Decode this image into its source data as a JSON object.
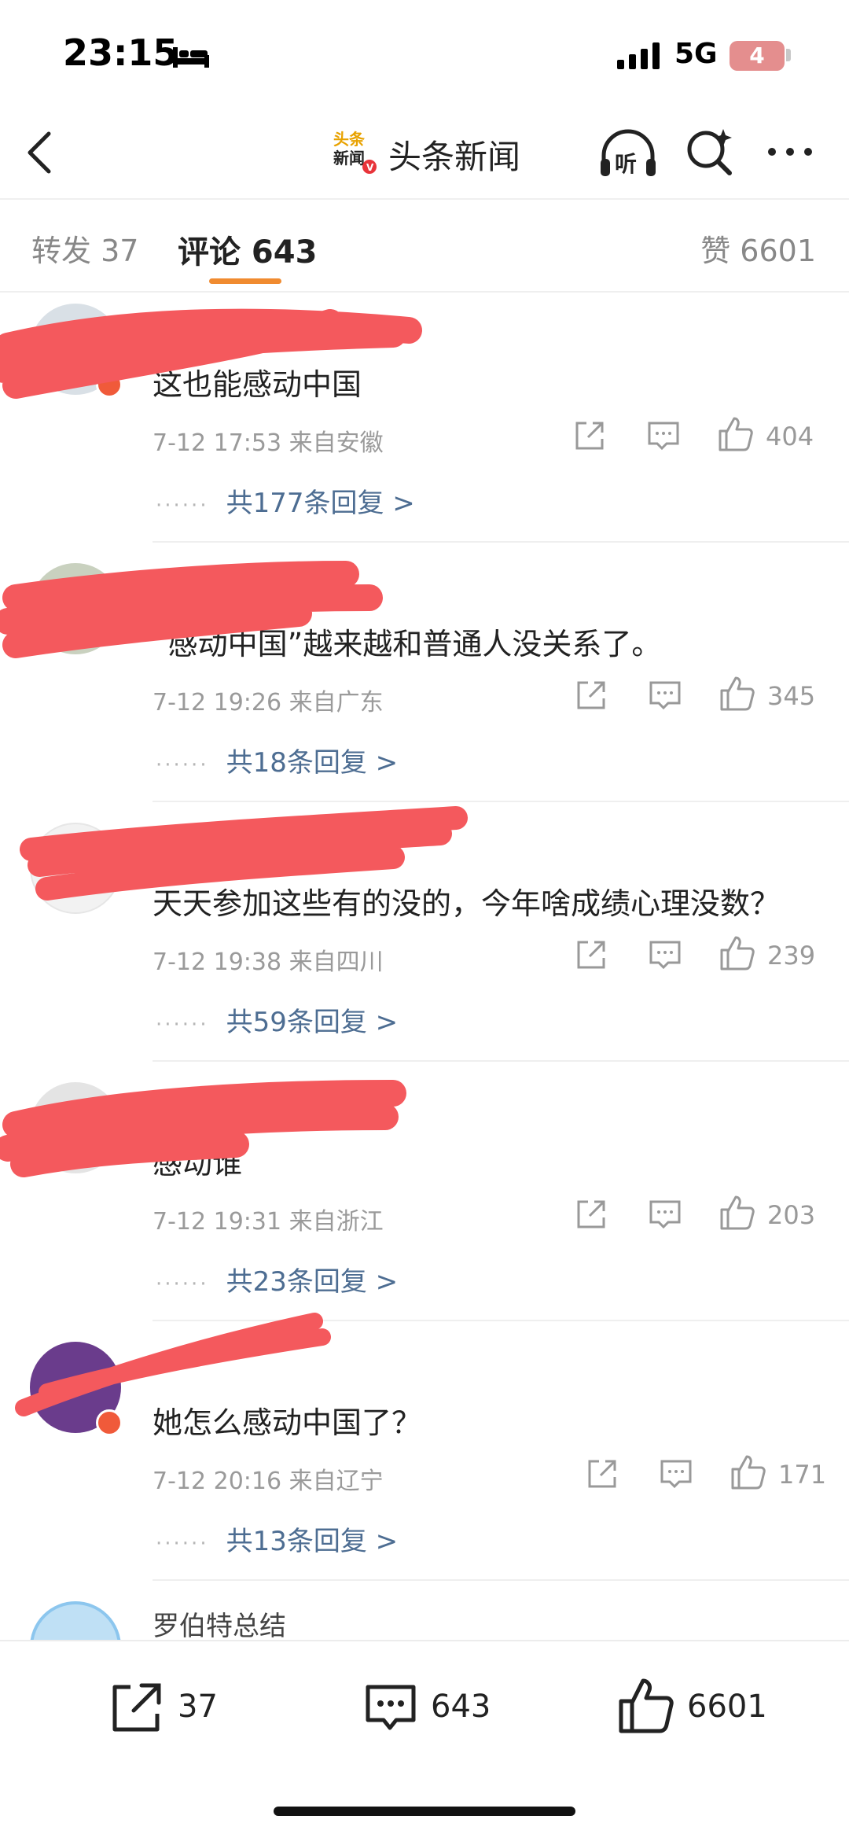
{
  "status_bar": {
    "time": "23:15",
    "network": "5G",
    "battery": "4",
    "icons": [
      "bed-icon",
      "signal-icon"
    ]
  },
  "nav": {
    "title": "头条新闻",
    "logo_text_top": "头条",
    "logo_text_bottom": "新闻",
    "listen_label": "听",
    "icons": [
      "back-icon",
      "listen-icon",
      "search-icon",
      "more-icon"
    ]
  },
  "tabs": {
    "repost": "转发 37",
    "comment": "评论 643",
    "like": "赞 6601",
    "accent_color": "#f08b30"
  },
  "comments": [
    {
      "username": "",
      "text": "这也能感动中国",
      "meta": "7-12 17:53  来自安徽",
      "likes": "404",
      "replies": "共177条回复 >"
    },
    {
      "username": "",
      "text": "“感动中国”越来越和普通人没关系了。",
      "meta": "7-12 19:26  来自广东",
      "likes": "345",
      "replies": "共18条回复 >"
    },
    {
      "username": "",
      "text": "天天参加这些有的没的，今年啥成绩心理没数？",
      "meta": "7-12 19:38  来自四川",
      "likes": "239",
      "replies": "共59条回复 >"
    },
    {
      "username": "",
      "text": "感动谁",
      "meta": "7-12 19:31  来自浙江",
      "likes": "203",
      "replies": "共23条回复 >"
    },
    {
      "username": "",
      "text": "她怎么感动中国了？",
      "meta": "7-12 20:16  来自辽宁",
      "likes": "171",
      "replies": "共13条回复 >"
    }
  ],
  "last_comment": {
    "username": "罗伯特总结"
  },
  "reply_dots": "······",
  "bottom_bar": {
    "share_count": "37",
    "comment_count": "643",
    "like_count": "6601"
  },
  "colors": {
    "link_blue": "#4d6d92",
    "redaction": "#f4595d",
    "badge": "#f05a3a"
  }
}
